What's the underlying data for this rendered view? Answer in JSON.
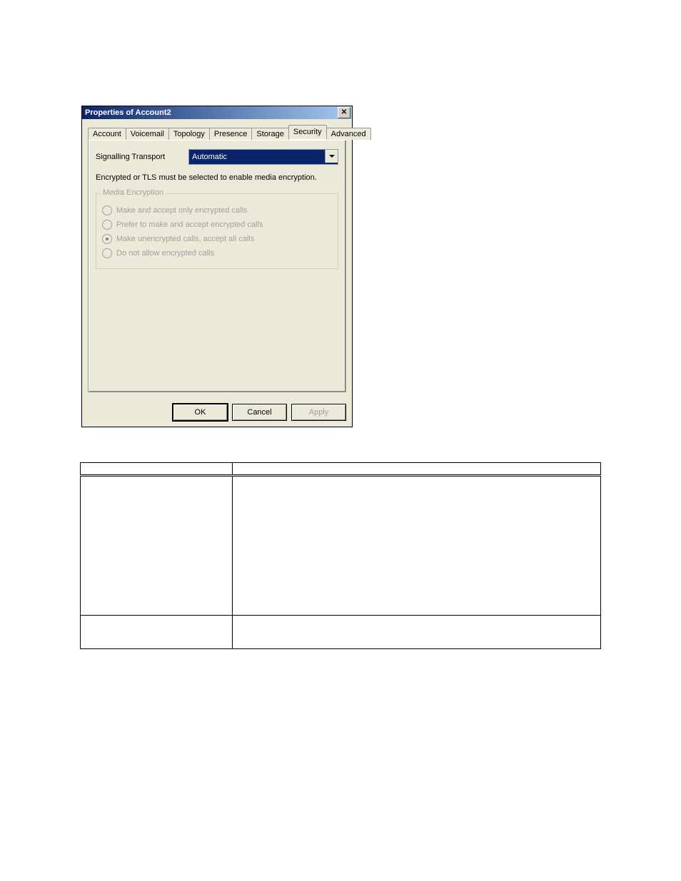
{
  "dialog": {
    "title": "Properties of Account2",
    "tabs": [
      "Account",
      "Voicemail",
      "Topology",
      "Presence",
      "Storage",
      "Security",
      "Advanced"
    ],
    "active_tab_index": 5,
    "transport_label": "Signalling Transport",
    "transport_value": "Automatic",
    "hint": "Encrypted or TLS must be selected to enable media encryption.",
    "groupbox_title": "Media Encryption",
    "radios": [
      {
        "label": "Make and accept only encrypted calls",
        "selected": false
      },
      {
        "label": "Prefer to make and accept encrypted calls",
        "selected": false
      },
      {
        "label": "Make unencrypted calls, accept all calls",
        "selected": true
      },
      {
        "label": "Do not allow encrypted calls",
        "selected": false
      }
    ],
    "ok_label": "OK",
    "cancel_label": "Cancel",
    "apply_label": "Apply"
  }
}
